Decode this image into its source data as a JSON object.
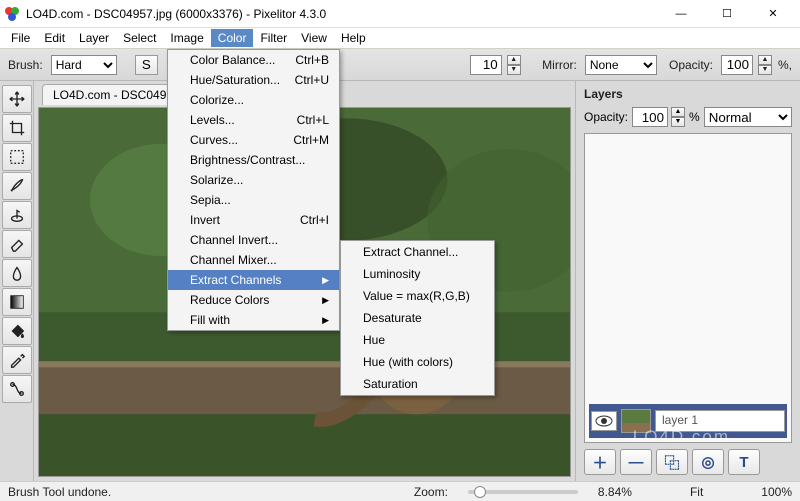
{
  "window": {
    "title": "LO4D.com - DSC04957.jpg (6000x3376) - Pixelitor 4.3.0",
    "min": "—",
    "max": "☐",
    "close": "✕"
  },
  "menubar": [
    "File",
    "Edit",
    "Layer",
    "Select",
    "Image",
    "Color",
    "Filter",
    "View",
    "Help"
  ],
  "menubar_open_index": 5,
  "toolbar": {
    "brush_label": "Brush:",
    "brush_value": "Hard",
    "size_value": "10",
    "mirror_label": "Mirror:",
    "mirror_value": "None",
    "opacity_label": "Opacity:",
    "opacity_value": "100",
    "opacity_suffix": "%,"
  },
  "tab": {
    "label": "LO4D.com - DSC0495"
  },
  "color_menu": [
    {
      "label": "Color Balance...",
      "shortcut": "Ctrl+B"
    },
    {
      "label": "Hue/Saturation...",
      "shortcut": "Ctrl+U"
    },
    {
      "label": "Colorize..."
    },
    {
      "label": "Levels...",
      "shortcut": "Ctrl+L"
    },
    {
      "label": "Curves...",
      "shortcut": "Ctrl+M"
    },
    {
      "label": "Brightness/Contrast..."
    },
    {
      "label": "Solarize..."
    },
    {
      "label": "Sepia..."
    },
    {
      "label": "Invert",
      "shortcut": "Ctrl+I"
    },
    {
      "label": "Channel Invert..."
    },
    {
      "label": "Channel Mixer..."
    },
    {
      "label": "Extract Channels",
      "submenu": true,
      "highlight": true
    },
    {
      "label": "Reduce Colors",
      "submenu": true
    },
    {
      "label": "Fill with",
      "submenu": true
    }
  ],
  "extract_submenu": [
    {
      "label": "Extract Channel..."
    },
    {
      "sep": true
    },
    {
      "label": "Luminosity"
    },
    {
      "label": "Value = max(R,G,B)"
    },
    {
      "label": "Desaturate"
    },
    {
      "sep": true
    },
    {
      "label": "Hue"
    },
    {
      "label": "Hue (with colors)"
    },
    {
      "label": "Saturation"
    }
  ],
  "layers": {
    "header": "Layers",
    "opacity_label": "Opacity:",
    "opacity_value": "100",
    "opacity_pct": "%",
    "blend_value": "Normal",
    "item_name": "layer 1",
    "buttons": [
      "＋",
      "—",
      "⿻",
      "◎",
      "T"
    ]
  },
  "status": {
    "left": "Brush Tool undone.",
    "zoom_label": "Zoom:",
    "zoom_pct": "8.84%",
    "fit": "Fit",
    "hundred": "100%"
  },
  "watermark": "LO4D.com",
  "tools": [
    "move",
    "crop",
    "rect-select",
    "brush",
    "stamp",
    "eraser",
    "smudge",
    "gradient",
    "bucket",
    "eyedropper",
    "pen"
  ]
}
